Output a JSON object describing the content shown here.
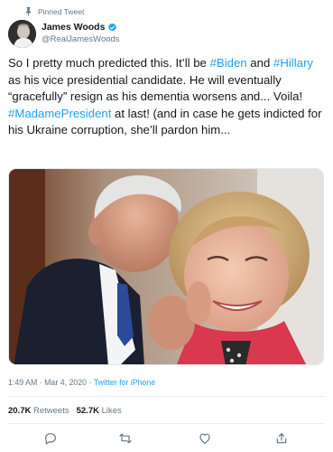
{
  "pinned": {
    "label": "Pinned Tweet",
    "icon": "pin-icon"
  },
  "author": {
    "name": "James Woods",
    "handle": "@RealJamesWoods",
    "verified_icon": "verified-badge-icon"
  },
  "tweet": {
    "segments": [
      {
        "text": "So I pretty much predicted this. It’ll be ",
        "hashtag": false
      },
      {
        "text": "#Biden",
        "hashtag": true
      },
      {
        "text": " and ",
        "hashtag": false
      },
      {
        "text": "#Hillary",
        "hashtag": true
      },
      {
        "text": " as his vice presidential candidate. He will eventually “gracefully” resign as his dementia worsens and... Voila! ",
        "hashtag": false
      },
      {
        "text": "#MadamePresident",
        "hashtag": true
      },
      {
        "text": " at last! (and in case he gets indicted for his Ukraine  corruption, she’ll pardon him...",
        "hashtag": false
      }
    ]
  },
  "meta": {
    "time": "1:49 AM",
    "sep": " · ",
    "date": "Mar 4, 2020",
    "source": "Twitter for iPhone"
  },
  "stats": {
    "retweets_count": "20.7K",
    "retweets_label": "Retweets",
    "likes_count": "52.7K",
    "likes_label": "Likes"
  },
  "actions": [
    "reply-icon",
    "retweet-icon",
    "like-icon",
    "share-icon"
  ],
  "colors": {
    "link": "#1da1f2",
    "muted": "#657786",
    "text": "#14171a"
  }
}
